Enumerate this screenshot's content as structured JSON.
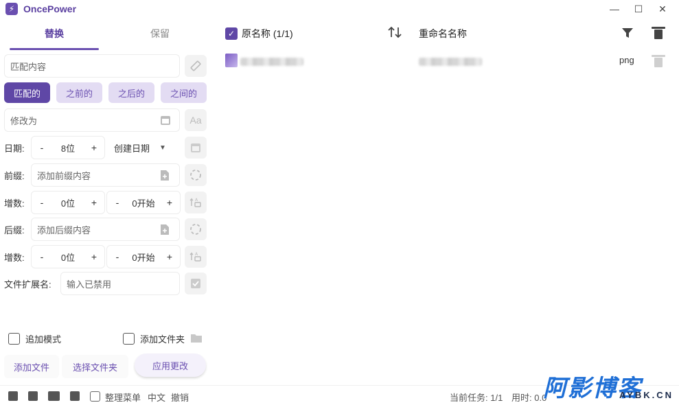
{
  "app": {
    "title": "OncePower",
    "logo_glyph": "⚡"
  },
  "window_controls": {
    "minimize": "—",
    "maximize": "☐",
    "close": "✕"
  },
  "tabs": [
    {
      "label": "替换"
    },
    {
      "label": "保留"
    }
  ],
  "match": {
    "placeholder": "匹配内容"
  },
  "match_modes": [
    {
      "label": "匹配的"
    },
    {
      "label": "之前的"
    },
    {
      "label": "之后的"
    },
    {
      "label": "之间的"
    }
  ],
  "replace": {
    "placeholder": "修改为"
  },
  "date_row": {
    "label": "日期:",
    "minus": "-",
    "value": "8位",
    "plus": "+",
    "dropdown": "创建日期",
    "caret": "▼"
  },
  "prefix_row": {
    "label": "前缀:",
    "placeholder": "添加前缀内容"
  },
  "prefix_inc": {
    "label": "增数:",
    "minus": "-",
    "digits": "0位",
    "plus": "+",
    "minus2": "-",
    "start": "0开始",
    "plus2": "+"
  },
  "suffix_row": {
    "label": "后缀:",
    "placeholder": "添加后缀内容"
  },
  "suffix_inc": {
    "label": "增数:",
    "minus": "-",
    "digits": "0位",
    "plus": "+",
    "minus2": "-",
    "start": "0开始",
    "plus2": "+"
  },
  "ext_row": {
    "label": "文件扩展名:",
    "placeholder": "输入已禁用"
  },
  "options": {
    "append_mode": "追加模式",
    "add_folder": "添加文件夹"
  },
  "buttons": {
    "add_file": "添加文件",
    "select_folder": "选择文件夹",
    "apply": "应用更改"
  },
  "list_header": {
    "original": "原名称 (1/1)",
    "renamed": "重命名名称",
    "check": "✓"
  },
  "files": [
    {
      "extension": "png"
    }
  ],
  "statusbar": {
    "organize_menu": "整理菜单",
    "language": "中文",
    "undo": "撤销",
    "task": "当前任务: 1/1",
    "time": "用时: 0.0"
  },
  "watermark": {
    "main": "阿影博客",
    "sub": "AYBK.CN"
  },
  "colors": {
    "accent": "#5f47a6",
    "accent_light": "#e3dcf3",
    "watermark": "#1f6fd6"
  },
  "icons": [
    "ruler-icon",
    "calendar-icon",
    "font-case-icon",
    "file-plus-icon",
    "dashed-circle-icon",
    "sort-letters-icon",
    "checkbox-icon",
    "folder-icon",
    "sort-icon",
    "filter-icon",
    "trash-icon",
    "save-icon",
    "clipboard-icon",
    "image-icon",
    "csv-icon"
  ]
}
